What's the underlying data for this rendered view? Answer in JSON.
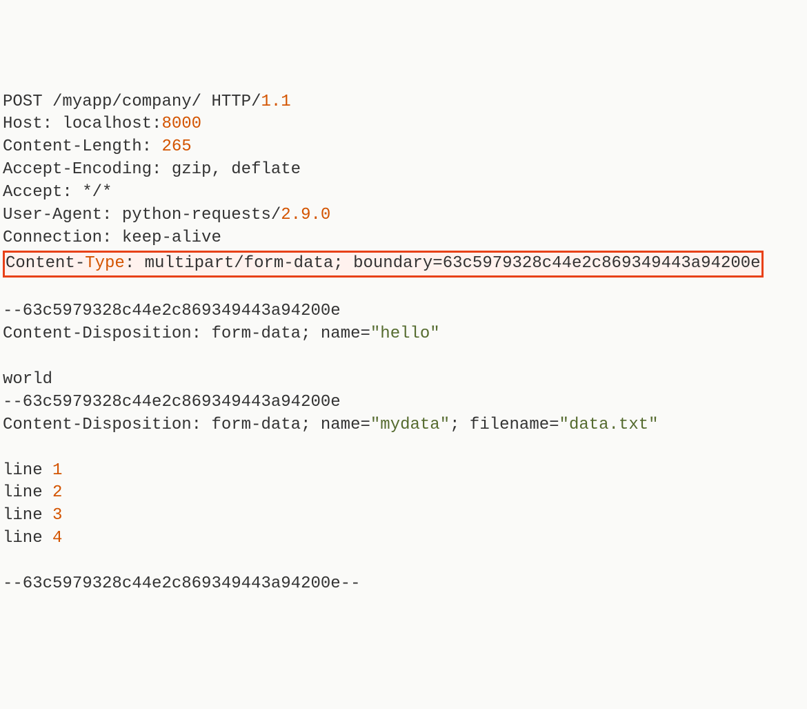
{
  "request": {
    "method": "POST",
    "path": "/myapp/company/",
    "httpVersion": "HTTP/",
    "httpVersionNum": "1.1",
    "headers": {
      "hostLabel": "Host: ",
      "hostValue": "localhost:",
      "hostPort": "8000",
      "contentLengthLabel": "Content-Length: ",
      "contentLengthValue": "265",
      "acceptEncodingLabel": "Accept-Encoding: ",
      "acceptEncodingValue": "gzip, deflate",
      "acceptLabel": "Accept: ",
      "acceptValue": "*/*",
      "userAgentLabel": "User-Agent: ",
      "userAgentValue": "python-requests/",
      "userAgentVersion": "2.9.0",
      "connectionLabel": "Connection: ",
      "connectionValue": "keep-alive",
      "contentTypePrefix": "Content-",
      "contentTypeWord": "Type",
      "contentTypeColon": ": ",
      "contentTypeValue": "multipart/form-data; boundary=63c5979328c44e2c869349443a94200e"
    },
    "body": {
      "boundary1": "--63c5979328c44e2c869349443a94200e",
      "disp1Prefix": "Content-Disposition: form-data; name=",
      "disp1Name": "\"hello\"",
      "part1Value": "world",
      "boundary2": "--63c5979328c44e2c869349443a94200e",
      "disp2Prefix": "Content-Disposition: form-data; name=",
      "disp2Name": "\"mydata\"",
      "disp2FilePrefix": "; filename=",
      "disp2Filename": "\"data.txt\"",
      "linePrefix": "line ",
      "lineNums": {
        "n1": "1",
        "n2": "2",
        "n3": "3",
        "n4": "4"
      },
      "boundaryEnd": "--63c5979328c44e2c869349443a94200e--"
    }
  }
}
